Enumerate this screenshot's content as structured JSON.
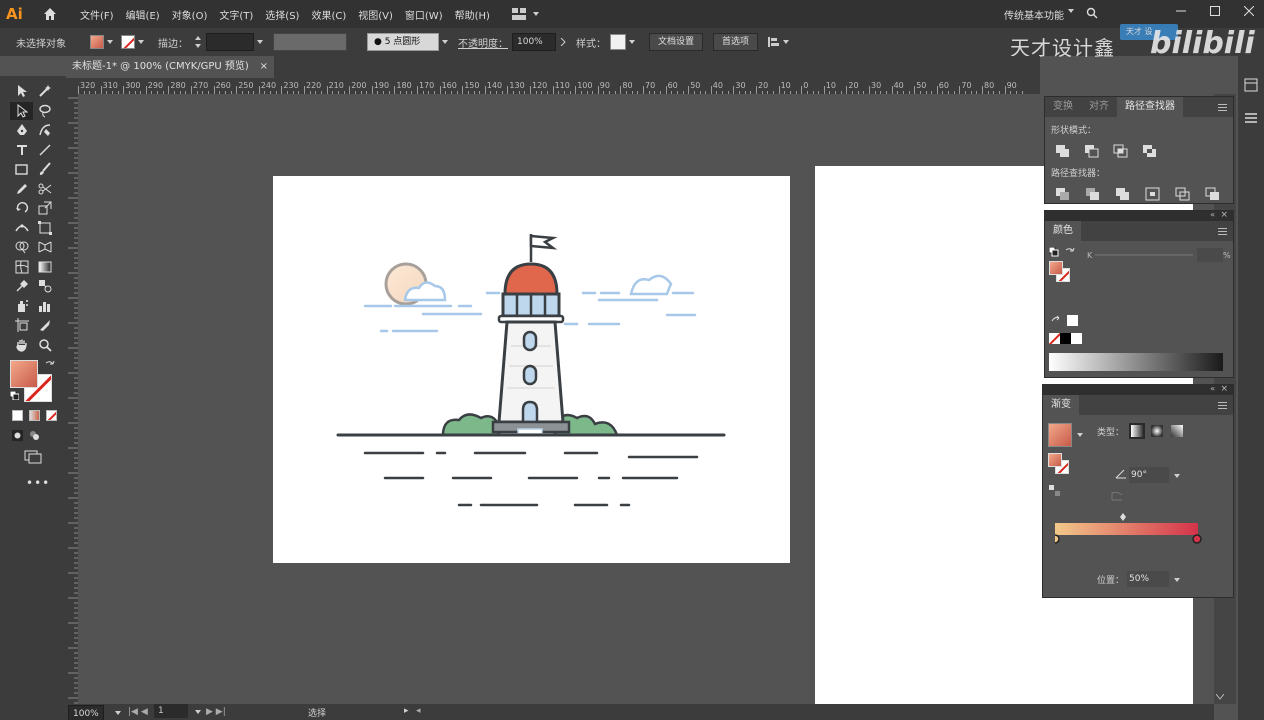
{
  "app": {
    "logo": "Ai"
  },
  "menu": [
    "文件(F)",
    "编辑(E)",
    "对象(O)",
    "文字(T)",
    "选择(S)",
    "效果(C)",
    "视图(V)",
    "窗口(W)",
    "帮助(H)"
  ],
  "workspace": "传统基本功能",
  "watermark": {
    "text": "天才设计鑫",
    "brand": "bilibili",
    "tag": "天才  设"
  },
  "control": {
    "selection": "未选择对象",
    "stroke_label": "描边：",
    "brush": "5 点圆形",
    "opacity_label": "不透明度：",
    "opacity": "100%",
    "style_label": "样式：",
    "doc_setup": "文档设置",
    "prefs": "首选项"
  },
  "tab": {
    "title": "未标题-1* @ 100% (CMYK/GPU 预览)",
    "close": "×"
  },
  "ruler": {
    "labels": [
      "320",
      "310",
      "300",
      "290",
      "280",
      "270",
      "260",
      "250",
      "240",
      "230",
      "220",
      "210",
      "200",
      "190",
      "180",
      "170",
      "160",
      "150",
      "140",
      "130",
      "120",
      "110",
      "100",
      "90",
      "80",
      "70",
      "60",
      "50",
      "40",
      "30",
      "20",
      "10",
      "0",
      "10",
      "20",
      "30",
      "40",
      "50",
      "60",
      "70",
      "80",
      "90"
    ]
  },
  "status": {
    "zoom": "100%",
    "page": "1",
    "mode": "选择"
  },
  "pathfinder": {
    "tabs": [
      "变换",
      "对齐",
      "路径查找器"
    ],
    "shape_modes": "形状模式：",
    "pathfinders": "路径查找器："
  },
  "color_panel": {
    "title": "颜色",
    "k": "K",
    "pct": "%"
  },
  "gradient": {
    "title": "渐变",
    "type_label": "类型：",
    "angle": "90°",
    "position_label": "位置：",
    "position": "50%"
  },
  "colors": {
    "grad_start": "#f2c98a",
    "grad_end": "#d4334a"
  }
}
